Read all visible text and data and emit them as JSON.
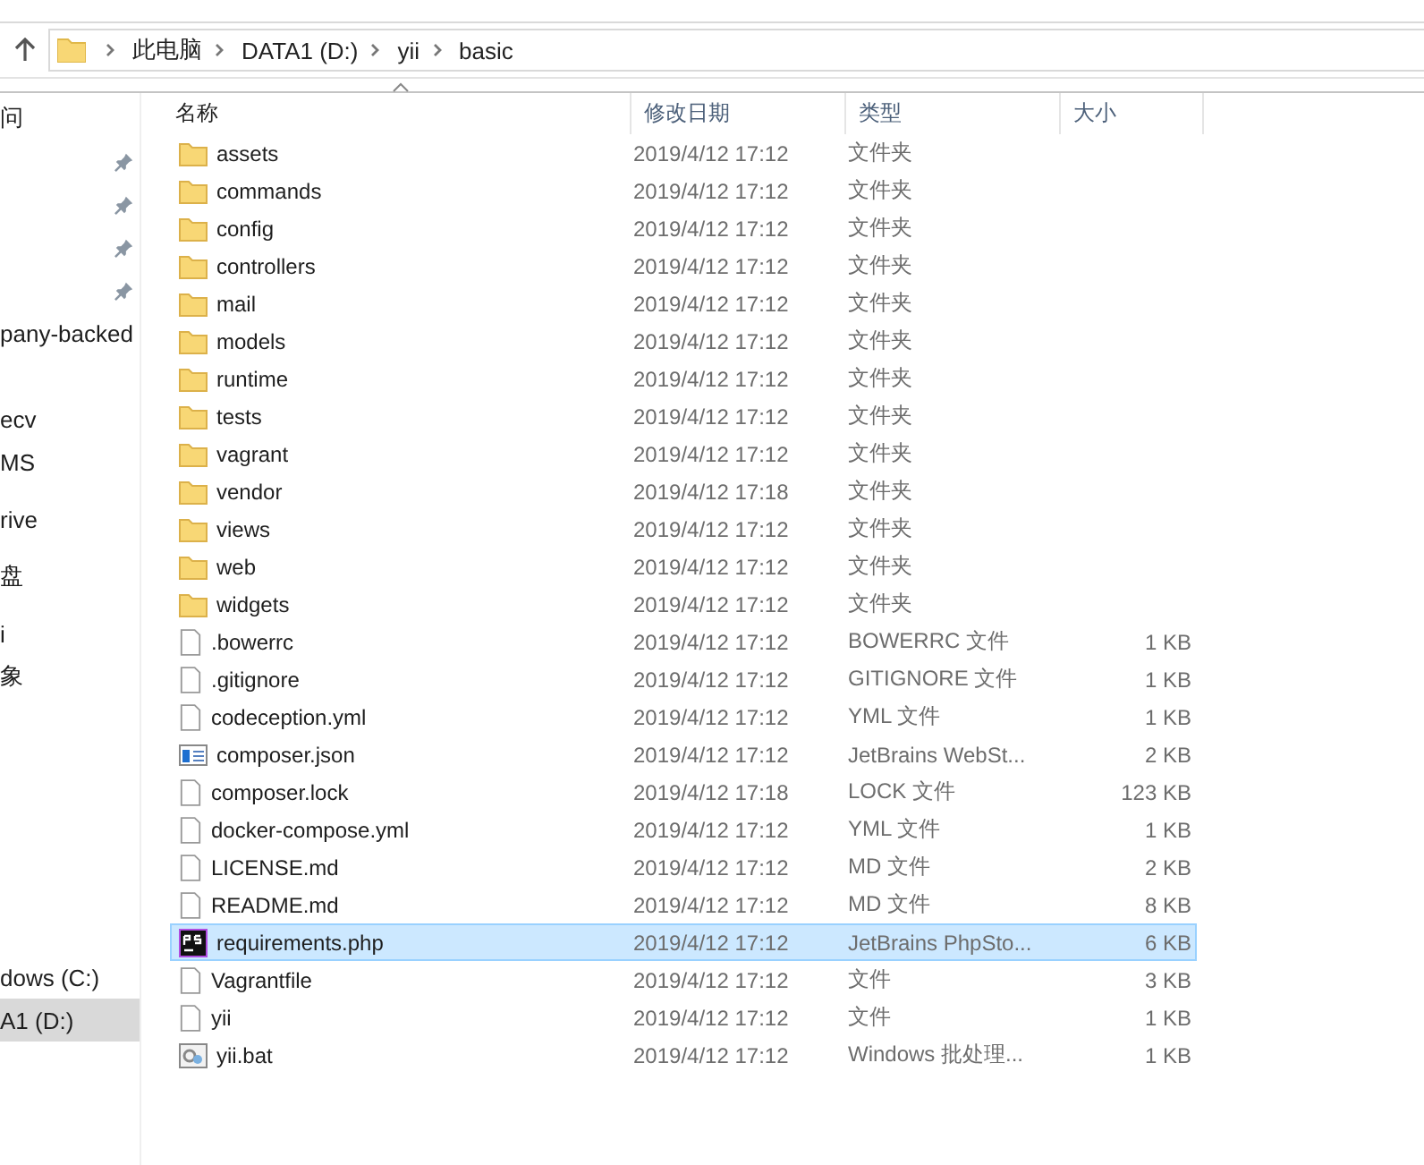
{
  "address_bar": {
    "path": [
      "此电脑",
      "DATA1 (D:)",
      "yii",
      "basic"
    ]
  },
  "sidebar": {
    "items": [
      {
        "label": "问",
        "pinned": false,
        "selected": false
      },
      {
        "pinned": true,
        "selected": false
      },
      {
        "pinned": true,
        "selected": false
      },
      {
        "pinned": true,
        "selected": false
      },
      {
        "pinned": true,
        "selected": false
      },
      {
        "label": "pany-backed",
        "pinned": false,
        "selected": false
      },
      {
        "label": "ecv",
        "pinned": false,
        "selected": false
      },
      {
        "label": "MS",
        "pinned": false,
        "selected": false
      },
      {
        "label": "rive",
        "pinned": false,
        "selected": false
      },
      {
        "label": "盘",
        "pinned": false,
        "selected": false
      },
      {
        "label": "i",
        "pinned": false,
        "selected": false
      },
      {
        "label": "象",
        "pinned": false,
        "selected": false
      },
      {
        "label": "dows (C:)",
        "pinned": false,
        "selected": false
      },
      {
        "label": "A1 (D:)",
        "pinned": false,
        "selected": true
      }
    ]
  },
  "table": {
    "columns": [
      "名称",
      "修改日期",
      "类型",
      "大小"
    ],
    "rows": [
      {
        "kind": "folder",
        "name": "assets",
        "modified": "2019/4/12 17:12",
        "type": "文件夹",
        "selected": false
      },
      {
        "kind": "folder",
        "name": "commands",
        "modified": "2019/4/12 17:12",
        "type": "文件夹",
        "selected": false
      },
      {
        "kind": "folder",
        "name": "config",
        "modified": "2019/4/12 17:12",
        "type": "文件夹",
        "selected": false
      },
      {
        "kind": "folder",
        "name": "controllers",
        "modified": "2019/4/12 17:12",
        "type": "文件夹",
        "selected": false
      },
      {
        "kind": "folder",
        "name": "mail",
        "modified": "2019/4/12 17:12",
        "type": "文件夹",
        "selected": false
      },
      {
        "kind": "folder",
        "name": "models",
        "modified": "2019/4/12 17:12",
        "type": "文件夹",
        "selected": false
      },
      {
        "kind": "folder",
        "name": "runtime",
        "modified": "2019/4/12 17:12",
        "type": "文件夹",
        "selected": false
      },
      {
        "kind": "folder",
        "name": "tests",
        "modified": "2019/4/12 17:12",
        "type": "文件夹",
        "selected": false
      },
      {
        "kind": "folder",
        "name": "vagrant",
        "modified": "2019/4/12 17:12",
        "type": "文件夹",
        "selected": false
      },
      {
        "kind": "folder",
        "name": "vendor",
        "modified": "2019/4/12 17:18",
        "type": "文件夹",
        "selected": false
      },
      {
        "kind": "folder",
        "name": "views",
        "modified": "2019/4/12 17:12",
        "type": "文件夹",
        "selected": false
      },
      {
        "kind": "folder",
        "name": "web",
        "modified": "2019/4/12 17:12",
        "type": "文件夹",
        "selected": false
      },
      {
        "kind": "folder",
        "name": "widgets",
        "modified": "2019/4/12 17:12",
        "type": "文件夹",
        "selected": false
      },
      {
        "kind": "file",
        "name": ".bowerrc",
        "modified": "2019/4/12 17:12",
        "type": "BOWERRC 文件",
        "size": "1 KB",
        "selected": false
      },
      {
        "kind": "file",
        "name": ".gitignore",
        "modified": "2019/4/12 17:12",
        "type": "GITIGNORE 文件",
        "size": "1 KB",
        "selected": false
      },
      {
        "kind": "file",
        "name": "codeception.yml",
        "modified": "2019/4/12 17:12",
        "type": "YML 文件",
        "size": "1 KB",
        "selected": false
      },
      {
        "kind": "json",
        "name": "composer.json",
        "modified": "2019/4/12 17:12",
        "type": "JetBrains WebSt...",
        "size": "2 KB",
        "selected": false
      },
      {
        "kind": "file",
        "name": "composer.lock",
        "modified": "2019/4/12 17:18",
        "type": "LOCK 文件",
        "size": "123 KB",
        "selected": false
      },
      {
        "kind": "file",
        "name": "docker-compose.yml",
        "modified": "2019/4/12 17:12",
        "type": "YML 文件",
        "size": "1 KB",
        "selected": false
      },
      {
        "kind": "file",
        "name": "LICENSE.md",
        "modified": "2019/4/12 17:12",
        "type": "MD 文件",
        "size": "2 KB",
        "selected": false
      },
      {
        "kind": "file",
        "name": "README.md",
        "modified": "2019/4/12 17:12",
        "type": "MD 文件",
        "size": "8 KB",
        "selected": false
      },
      {
        "kind": "phpstorm",
        "name": "requirements.php",
        "modified": "2019/4/12 17:12",
        "type": "JetBrains PhpSto...",
        "size": "6 KB",
        "selected": true
      },
      {
        "kind": "file",
        "name": "Vagrantfile",
        "modified": "2019/4/12 17:12",
        "type": "文件",
        "size": "3 KB",
        "selected": false
      },
      {
        "kind": "file",
        "name": "yii",
        "modified": "2019/4/12 17:12",
        "type": "文件",
        "size": "1 KB",
        "selected": false
      },
      {
        "kind": "bat",
        "name": "yii.bat",
        "modified": "2019/4/12 17:12",
        "type": "Windows 批处理...",
        "size": "1 KB",
        "selected": false
      }
    ]
  }
}
